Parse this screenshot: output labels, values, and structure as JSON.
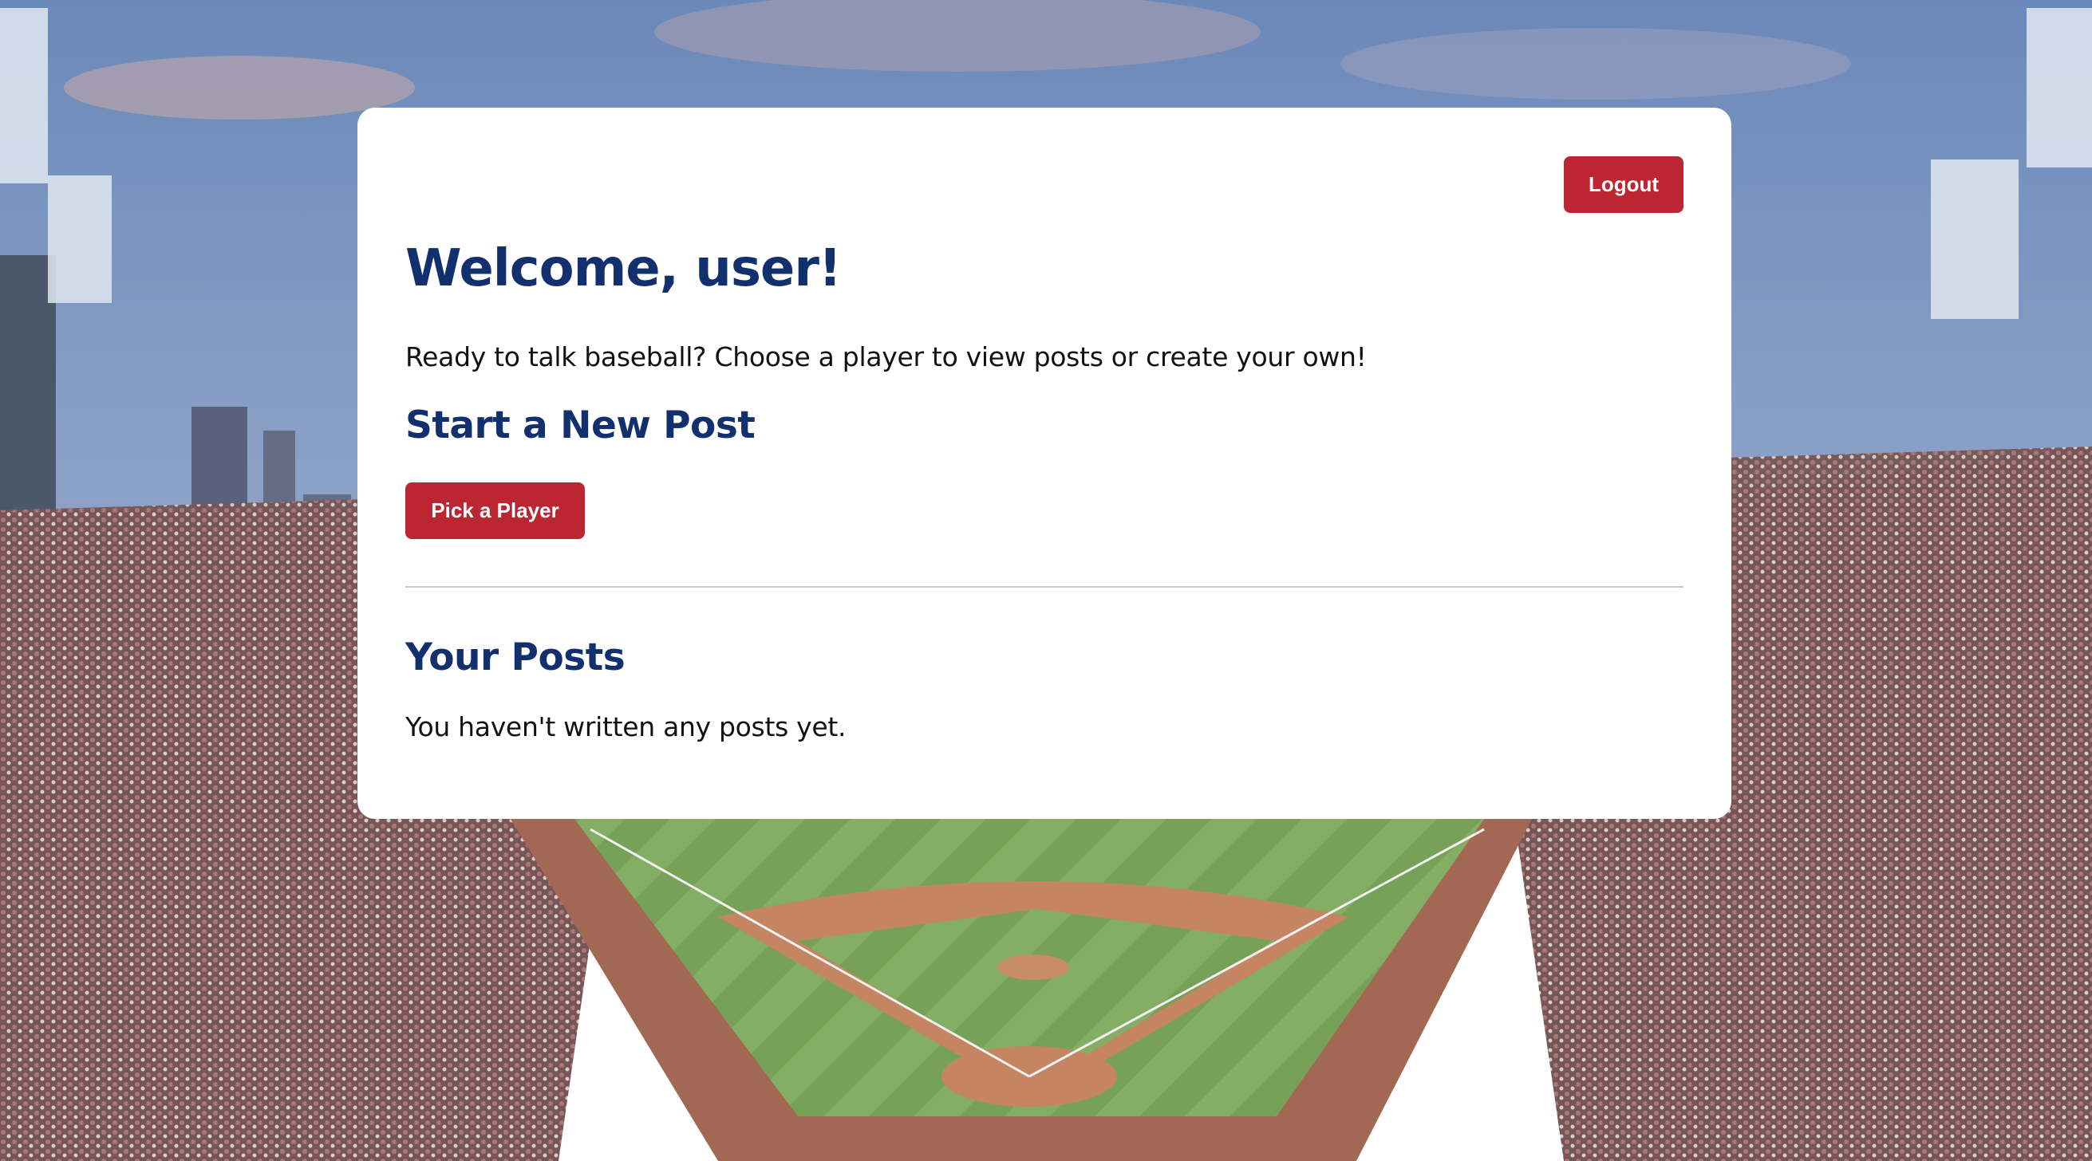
{
  "background": {
    "description_icon": "baseball-stadium-background",
    "sky_color": "#6b87b5",
    "field_color": "#6f9a4c",
    "dirt_color": "#b8734c",
    "crowd_color": "#5a3d3d"
  },
  "header": {
    "logout_label": "Logout"
  },
  "main": {
    "welcome_title": "Welcome, user!",
    "intro_text": "Ready to talk baseball? Choose a player to view posts or create your own!",
    "new_post": {
      "title": "Start a New Post",
      "button_label": "Pick a Player"
    },
    "your_posts": {
      "title": "Your Posts",
      "empty_message": "You haven't written any posts yet."
    }
  },
  "colors": {
    "accent_red": "#bc2633",
    "heading_navy": "#13306e",
    "card_bg": "#ffffff"
  }
}
